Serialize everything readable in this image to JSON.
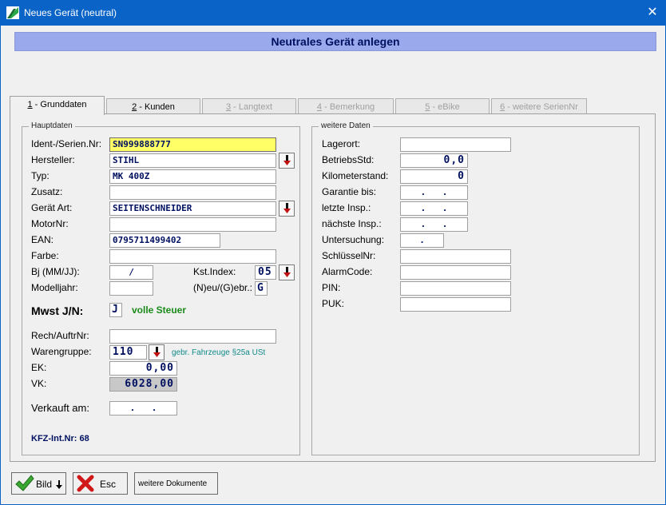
{
  "window": {
    "title": "Neues Gerät (neutral)",
    "close_glyph": "✕"
  },
  "header": {
    "title": "Neutrales Gerät anlegen"
  },
  "tabs": [
    {
      "key": "1",
      "label": " - Grunddaten"
    },
    {
      "key": "2",
      "label": " - Kunden"
    },
    {
      "key": "3",
      "label": " - Langtext"
    },
    {
      "key": "4",
      "label": " - Bemerkung"
    },
    {
      "key": "5",
      "label": " - eBike"
    },
    {
      "key": "6",
      "label": " - weitere SerienNr"
    }
  ],
  "hauptdaten": {
    "group_title": "Hauptdaten",
    "ident_label": "Ident-/Serien.Nr:",
    "ident_value": "SN999888777",
    "hersteller_label": "Hersteller:",
    "hersteller_value": "STIHL",
    "typ_label": "Typ:",
    "typ_value": "MK 400Z",
    "zusatz_label": "Zusatz:",
    "zusatz_value": "",
    "geraet_art_label": "Gerät Art:",
    "geraet_art_value": "SEITENSCHNEIDER",
    "motornr_label": "MotorNr:",
    "motornr_value": "",
    "ean_label": "EAN:",
    "ean_value": "0795711499402",
    "farbe_label": "Farbe:",
    "farbe_value": "",
    "bj_label": "Bj (MM/JJ):",
    "bj_value": "/",
    "kst_label": "Kst.Index:",
    "kst_value": "05",
    "modelljahr_label": "Modelljahr:",
    "modelljahr_value": "",
    "neu_gebr_label": "(N)eu/(G)ebr.:",
    "neu_gebr_value": "G",
    "mwst_label": "Mwst J/N:",
    "mwst_value": "J",
    "mwst_note": "volle Steuer",
    "rech_label": "Rech/AuftrNr:",
    "rech_value": "",
    "warengruppe_label": "Warengruppe:",
    "warengruppe_value": "110",
    "warengruppe_note": "gebr. Fahrzeuge §25a USt",
    "ek_label": "EK:",
    "ek_value": "0,00",
    "vk_label": "VK:",
    "vk_value": "6028,00",
    "verkauft_label": "Verkauft am:",
    "verkauft_value": ". .",
    "kfz_int_nr": "KFZ-Int.Nr: 68"
  },
  "weitere": {
    "group_title": "weitere Daten",
    "lagerort_label": "Lagerort:",
    "lagerort_value": "",
    "betriebsstd_label": "BetriebsStd:",
    "betriebsstd_value": "0,0",
    "kilometer_label": "Kilometerstand:",
    "kilometer_value": "0",
    "garantie_label": "Garantie bis:",
    "garantie_value": ". .",
    "letzte_label": "letzte Insp.:",
    "letzte_value": ". .",
    "naechste_label": "nächste Insp.:",
    "naechste_value": ". .",
    "untersuchung_label": "Untersuchung:",
    "untersuchung_value": ".",
    "schluessel_label": "SchlüsselNr:",
    "schluessel_value": "",
    "alarm_label": "AlarmCode:",
    "alarm_value": "",
    "pin_label": "PIN:",
    "pin_value": "",
    "puk_label": "PUK:",
    "puk_value": ""
  },
  "footer": {
    "bild_label": "Bild",
    "esc_label": "Esc",
    "dokumente_label": "weitere Dokumente"
  },
  "colors": {
    "titlebar": "#0a64c8",
    "header_band": "#9aa9ec",
    "highlight_field": "#ffff66"
  }
}
